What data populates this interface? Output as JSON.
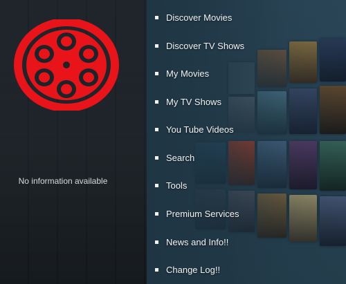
{
  "info_panel": {
    "message": "No information available"
  },
  "menu": {
    "items": [
      {
        "label": "Discover Movies"
      },
      {
        "label": "Discover TV Shows"
      },
      {
        "label": "My Movies"
      },
      {
        "label": "My TV Shows"
      },
      {
        "label": "You Tube Videos"
      },
      {
        "label": "Search"
      },
      {
        "label": "Tools"
      },
      {
        "label": "Premium Services"
      },
      {
        "label": "News and Info!!"
      },
      {
        "label": "Change Log!!"
      }
    ]
  },
  "colors": {
    "logo_red": "#e8141a",
    "menu_text": "#f2f4f6"
  },
  "icons": {
    "logo": "film-reel-icon",
    "bullet": "square-bullet-icon"
  }
}
